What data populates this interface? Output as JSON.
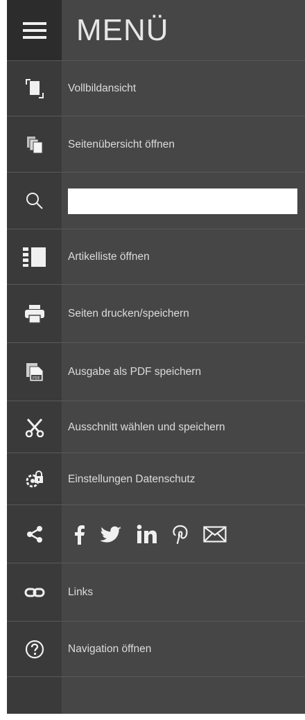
{
  "header": {
    "title": "MENÜ",
    "menu_icon": "hamburger-icon"
  },
  "search": {
    "value": "",
    "placeholder": ""
  },
  "items": [
    {
      "label": "Vollbildansicht",
      "icon": "fullscreen-icon"
    },
    {
      "label": "Seitenübersicht öffnen",
      "icon": "pages-icon"
    },
    {
      "label": "",
      "icon": "search-icon"
    },
    {
      "label": "Artikelliste öffnen",
      "icon": "article-list-icon"
    },
    {
      "label": "Seiten drucken/speichern",
      "icon": "printer-icon"
    },
    {
      "label": "Ausgabe als PDF speichern",
      "icon": "pdf-icon"
    },
    {
      "label": "Ausschnitt wählen und speichern",
      "icon": "scissors-icon"
    },
    {
      "label": "Einstellungen Datenschutz",
      "icon": "privacy-settings-icon"
    },
    {
      "label": "",
      "icon": "share-icon"
    },
    {
      "label": "Links",
      "icon": "link-icon"
    },
    {
      "label": "Navigation öffnen",
      "icon": "help-icon"
    }
  ],
  "social": [
    "facebook-icon",
    "twitter-icon",
    "linkedin-icon",
    "pinterest-icon",
    "mail-icon"
  ],
  "colors": {
    "panel": "#464646",
    "rail": "#3a3a3a",
    "header_icon_bg": "#2c2c2c",
    "text": "#dcdcdc"
  }
}
